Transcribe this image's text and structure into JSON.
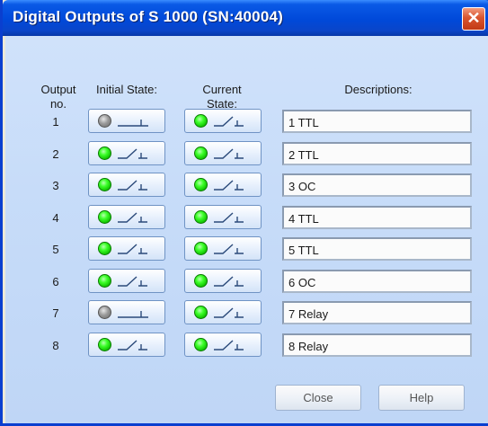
{
  "window": {
    "title": "Digital Outputs of S 1000 (SN:40004)",
    "close_glyph": "✕"
  },
  "headers": {
    "output_no_1": "Output",
    "output_no_2": "no.",
    "initial_state": "Initial State:",
    "current_state_1": "Current",
    "current_state_2": "State:",
    "descriptions": "Descriptions:"
  },
  "rows": [
    {
      "num": "1",
      "initial": "off",
      "current": "on",
      "desc": "1 TTL"
    },
    {
      "num": "2",
      "initial": "on",
      "current": "on",
      "desc": "2 TTL"
    },
    {
      "num": "3",
      "initial": "on",
      "current": "on",
      "desc": "3 OC"
    },
    {
      "num": "4",
      "initial": "on",
      "current": "on",
      "desc": "4 TTL"
    },
    {
      "num": "5",
      "initial": "on",
      "current": "on",
      "desc": "5 TTL"
    },
    {
      "num": "6",
      "initial": "on",
      "current": "on",
      "desc": "6 OC"
    },
    {
      "num": "7",
      "initial": "off",
      "current": "on",
      "desc": "7 Relay"
    },
    {
      "num": "8",
      "initial": "on",
      "current": "on",
      "desc": "8 Relay"
    }
  ],
  "buttons": {
    "close": "Close",
    "help": "Help"
  },
  "icons": {
    "led_on": "green-led-icon",
    "led_off": "gray-led-icon",
    "switch_open": "switch-open-icon",
    "switch_closed": "switch-closed-icon"
  },
  "colors": {
    "title_bar": "#0049d9",
    "client_bg": "#c7dcf9",
    "led_on": "#3dff2a",
    "led_off": "#9a9a9a",
    "close_button": "#d9552f"
  }
}
